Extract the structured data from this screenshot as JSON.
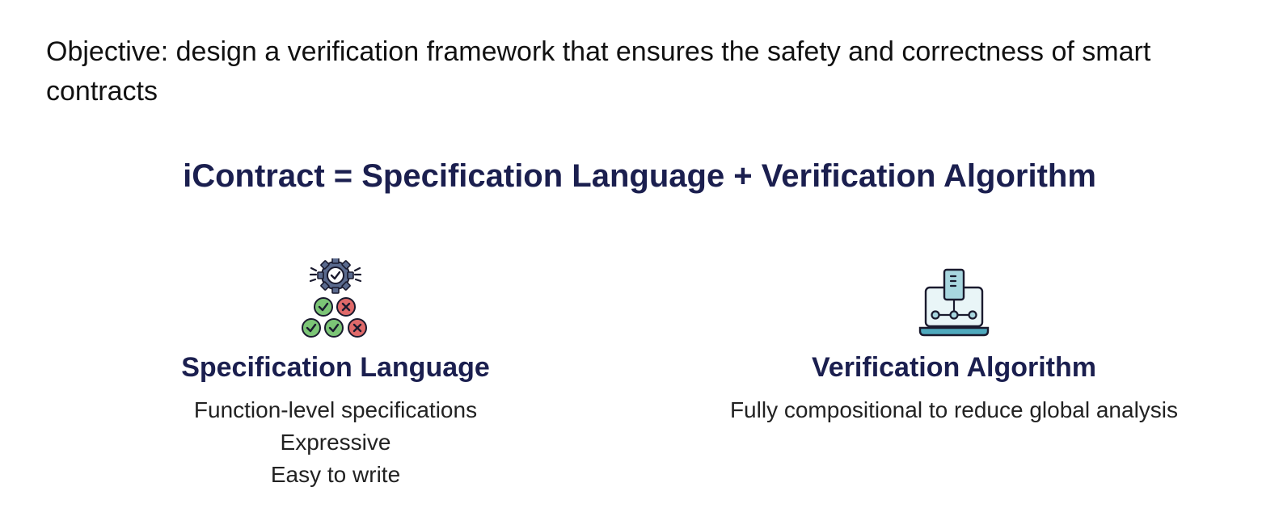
{
  "objective": "Objective: design a verification framework that ensures the safety and correctness of smart contracts",
  "equation": "iContract = Specification Language + Verification Algorithm",
  "columns": [
    {
      "icon": "gear-checklist-icon",
      "title": "Specification Language",
      "items": [
        "Function-level specifications",
        "Expressive",
        "Easy to write"
      ]
    },
    {
      "icon": "laptop-workflow-icon",
      "title": "Verification Algorithm",
      "items": [
        "Fully compositional to reduce global analysis"
      ]
    }
  ],
  "colors": {
    "heading": "#1b1f4f",
    "check": "#7cc576",
    "cross": "#e06a6a",
    "gear": "#5a6a8e",
    "screen": "#a8d6df"
  }
}
